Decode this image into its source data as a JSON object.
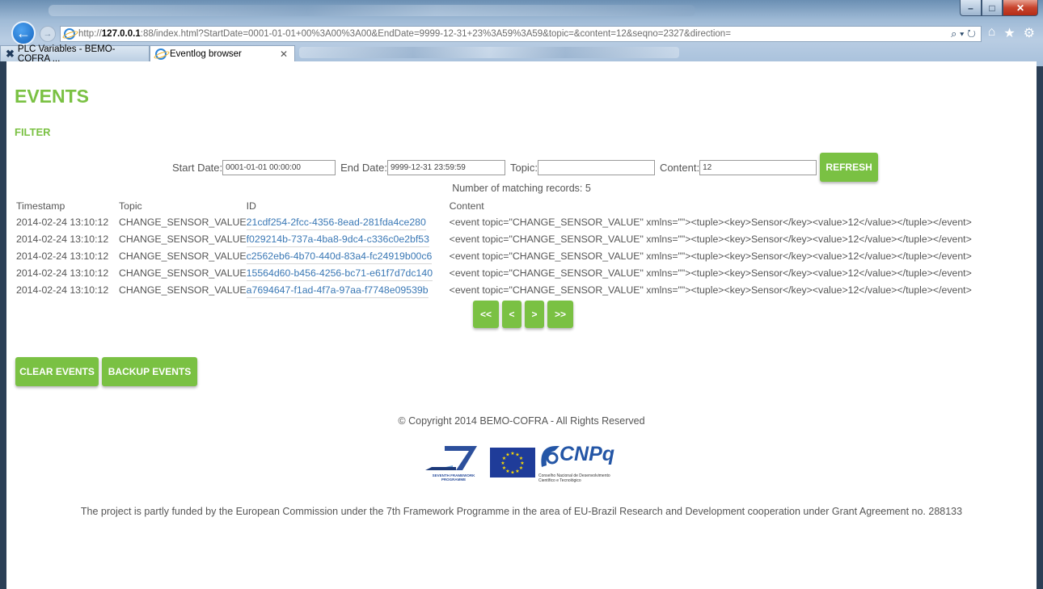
{
  "browser": {
    "address_url_prefix": "http://",
    "address_host": "127.0.0.1",
    "address_url_rest": ":88/index.html?StartDate=0001-01-01+00%3A00%3A00&EndDate=9999-12-31+23%3A59%3A59&topic=&content=12&seqno=2327&direction=",
    "tabs": [
      {
        "label": "PLC Variables - BEMO-COFRA ...",
        "active": false
      },
      {
        "label": "Eventlog browser",
        "active": true
      }
    ],
    "search_glyph": "⌕ ▾ ↻",
    "home_glyph": "⌂",
    "favorites_glyph": "★",
    "tools_glyph": "⚙"
  },
  "page": {
    "title": "EVENTS",
    "filter_title": "FILTER",
    "filter": {
      "start_label": "Start Date:",
      "start_value": "0001-01-01 00:00:00",
      "end_label": "End Date:",
      "end_value": "9999-12-31 23:59:59",
      "topic_label": "Topic:",
      "topic_value": "",
      "content_label": "Content:",
      "content_value": "12",
      "refresh_label": "REFRESH"
    },
    "matching_records": "Number of matching records: 5",
    "table": {
      "headers": [
        "Timestamp",
        "Topic",
        "ID",
        "Content"
      ],
      "rows": [
        {
          "timestamp": "2014-02-24 13:10:12",
          "topic": "CHANGE_SENSOR_VALUE",
          "id": "21cdf254-2fcc-4356-8ead-281fda4ce280",
          "content": "<event topic=\"CHANGE_SENSOR_VALUE\" xmlns=\"\"><tuple><key>Sensor</key><value>12</value></tuple></event>"
        },
        {
          "timestamp": "2014-02-24 13:10:12",
          "topic": "CHANGE_SENSOR_VALUE",
          "id": "f029214b-737a-4ba8-9dc4-c336c0e2bf53",
          "content": "<event topic=\"CHANGE_SENSOR_VALUE\" xmlns=\"\"><tuple><key>Sensor</key><value>12</value></tuple></event>"
        },
        {
          "timestamp": "2014-02-24 13:10:12",
          "topic": "CHANGE_SENSOR_VALUE",
          "id": "c2562eb6-4b70-440d-83a4-fc24919b00c6",
          "content": "<event topic=\"CHANGE_SENSOR_VALUE\" xmlns=\"\"><tuple><key>Sensor</key><value>12</value></tuple></event>"
        },
        {
          "timestamp": "2014-02-24 13:10:12",
          "topic": "CHANGE_SENSOR_VALUE",
          "id": "15564d60-b456-4256-bc71-e61f7d7dc140",
          "content": "<event topic=\"CHANGE_SENSOR_VALUE\" xmlns=\"\"><tuple><key>Sensor</key><value>12</value></tuple></event>"
        },
        {
          "timestamp": "2014-02-24 13:10:12",
          "topic": "CHANGE_SENSOR_VALUE",
          "id": "a7694647-f1ad-4f7a-97aa-f7748e09539b",
          "content": "<event topic=\"CHANGE_SENSOR_VALUE\" xmlns=\"\"><tuple><key>Sensor</key><value>12</value></tuple></event>"
        }
      ]
    },
    "pager": {
      "first": "<<",
      "prev": "<",
      "next": ">",
      "last": ">>"
    },
    "actions": {
      "clear_label": "CLEAR EVENTS",
      "backup_label": "BACKUP EVENTS"
    },
    "copyright": "© Copyright 2014 BEMO-COFRA - All Rights Reserved",
    "logos": {
      "fp7_caption_line1": "SEVENTH FRAMEWORK",
      "fp7_caption_line2": "PROGRAMME",
      "cnpq_word": "CNPq",
      "cnpq_caption_line1": "Conselho Nacional de Desenvolvimento",
      "cnpq_caption_line2": "Científico e Tecnológico"
    },
    "funding": "The project is partly funded by the European Commission under the 7th Framework Programme in the area of EU-Brazil Research and Development cooperation under Grant Agreement no. 288133"
  },
  "colors": {
    "accent_green": "#7ac143",
    "link_blue": "#3a78b5",
    "text_gray": "#555555",
    "eu_blue": "#1f3c99",
    "eu_star": "#ffdd00"
  }
}
